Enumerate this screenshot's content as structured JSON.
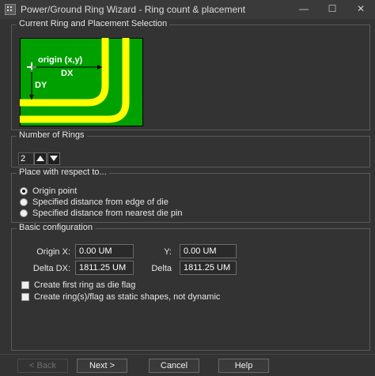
{
  "window": {
    "title": "Power/Ground Ring Wizard - Ring count & placement",
    "minimize": "—",
    "maximize": "☐",
    "close": "✕"
  },
  "ring_selection": {
    "title": "Current Ring and Placement Selection",
    "diagram": {
      "origin_label": "origin (x,y)",
      "dx_label": "DX",
      "dy_label": "DY",
      "colors": {
        "die": "#00a000",
        "ring": "#ffff00",
        "text": "#ffffff"
      }
    }
  },
  "rings": {
    "title": "Number of Rings",
    "value": "2"
  },
  "placement": {
    "title": "Place with respect to...",
    "options": [
      {
        "label": "Origin point",
        "checked": true
      },
      {
        "label": "Specified distance from edge of die",
        "checked": false
      },
      {
        "label": "Specified distance from nearest die pin",
        "checked": false
      }
    ]
  },
  "basic": {
    "title": "Basic configuration",
    "origin_x_label": "Origin X:",
    "origin_x_value": "0.00 UM",
    "y_label": "Y:",
    "y_value": "0.00 UM",
    "delta_dx_label": "Delta DX:",
    "delta_dx_value": "1811.25 UM",
    "delta_label": "Delta",
    "delta_value": "1811.25 UM",
    "checkbox1": "Create first ring as die flag",
    "checkbox2": "Create ring(s)/flag as static shapes, not dynamic"
  },
  "buttons": {
    "back": "< Back",
    "next": "Next >",
    "cancel": "Cancel",
    "help": "Help"
  }
}
